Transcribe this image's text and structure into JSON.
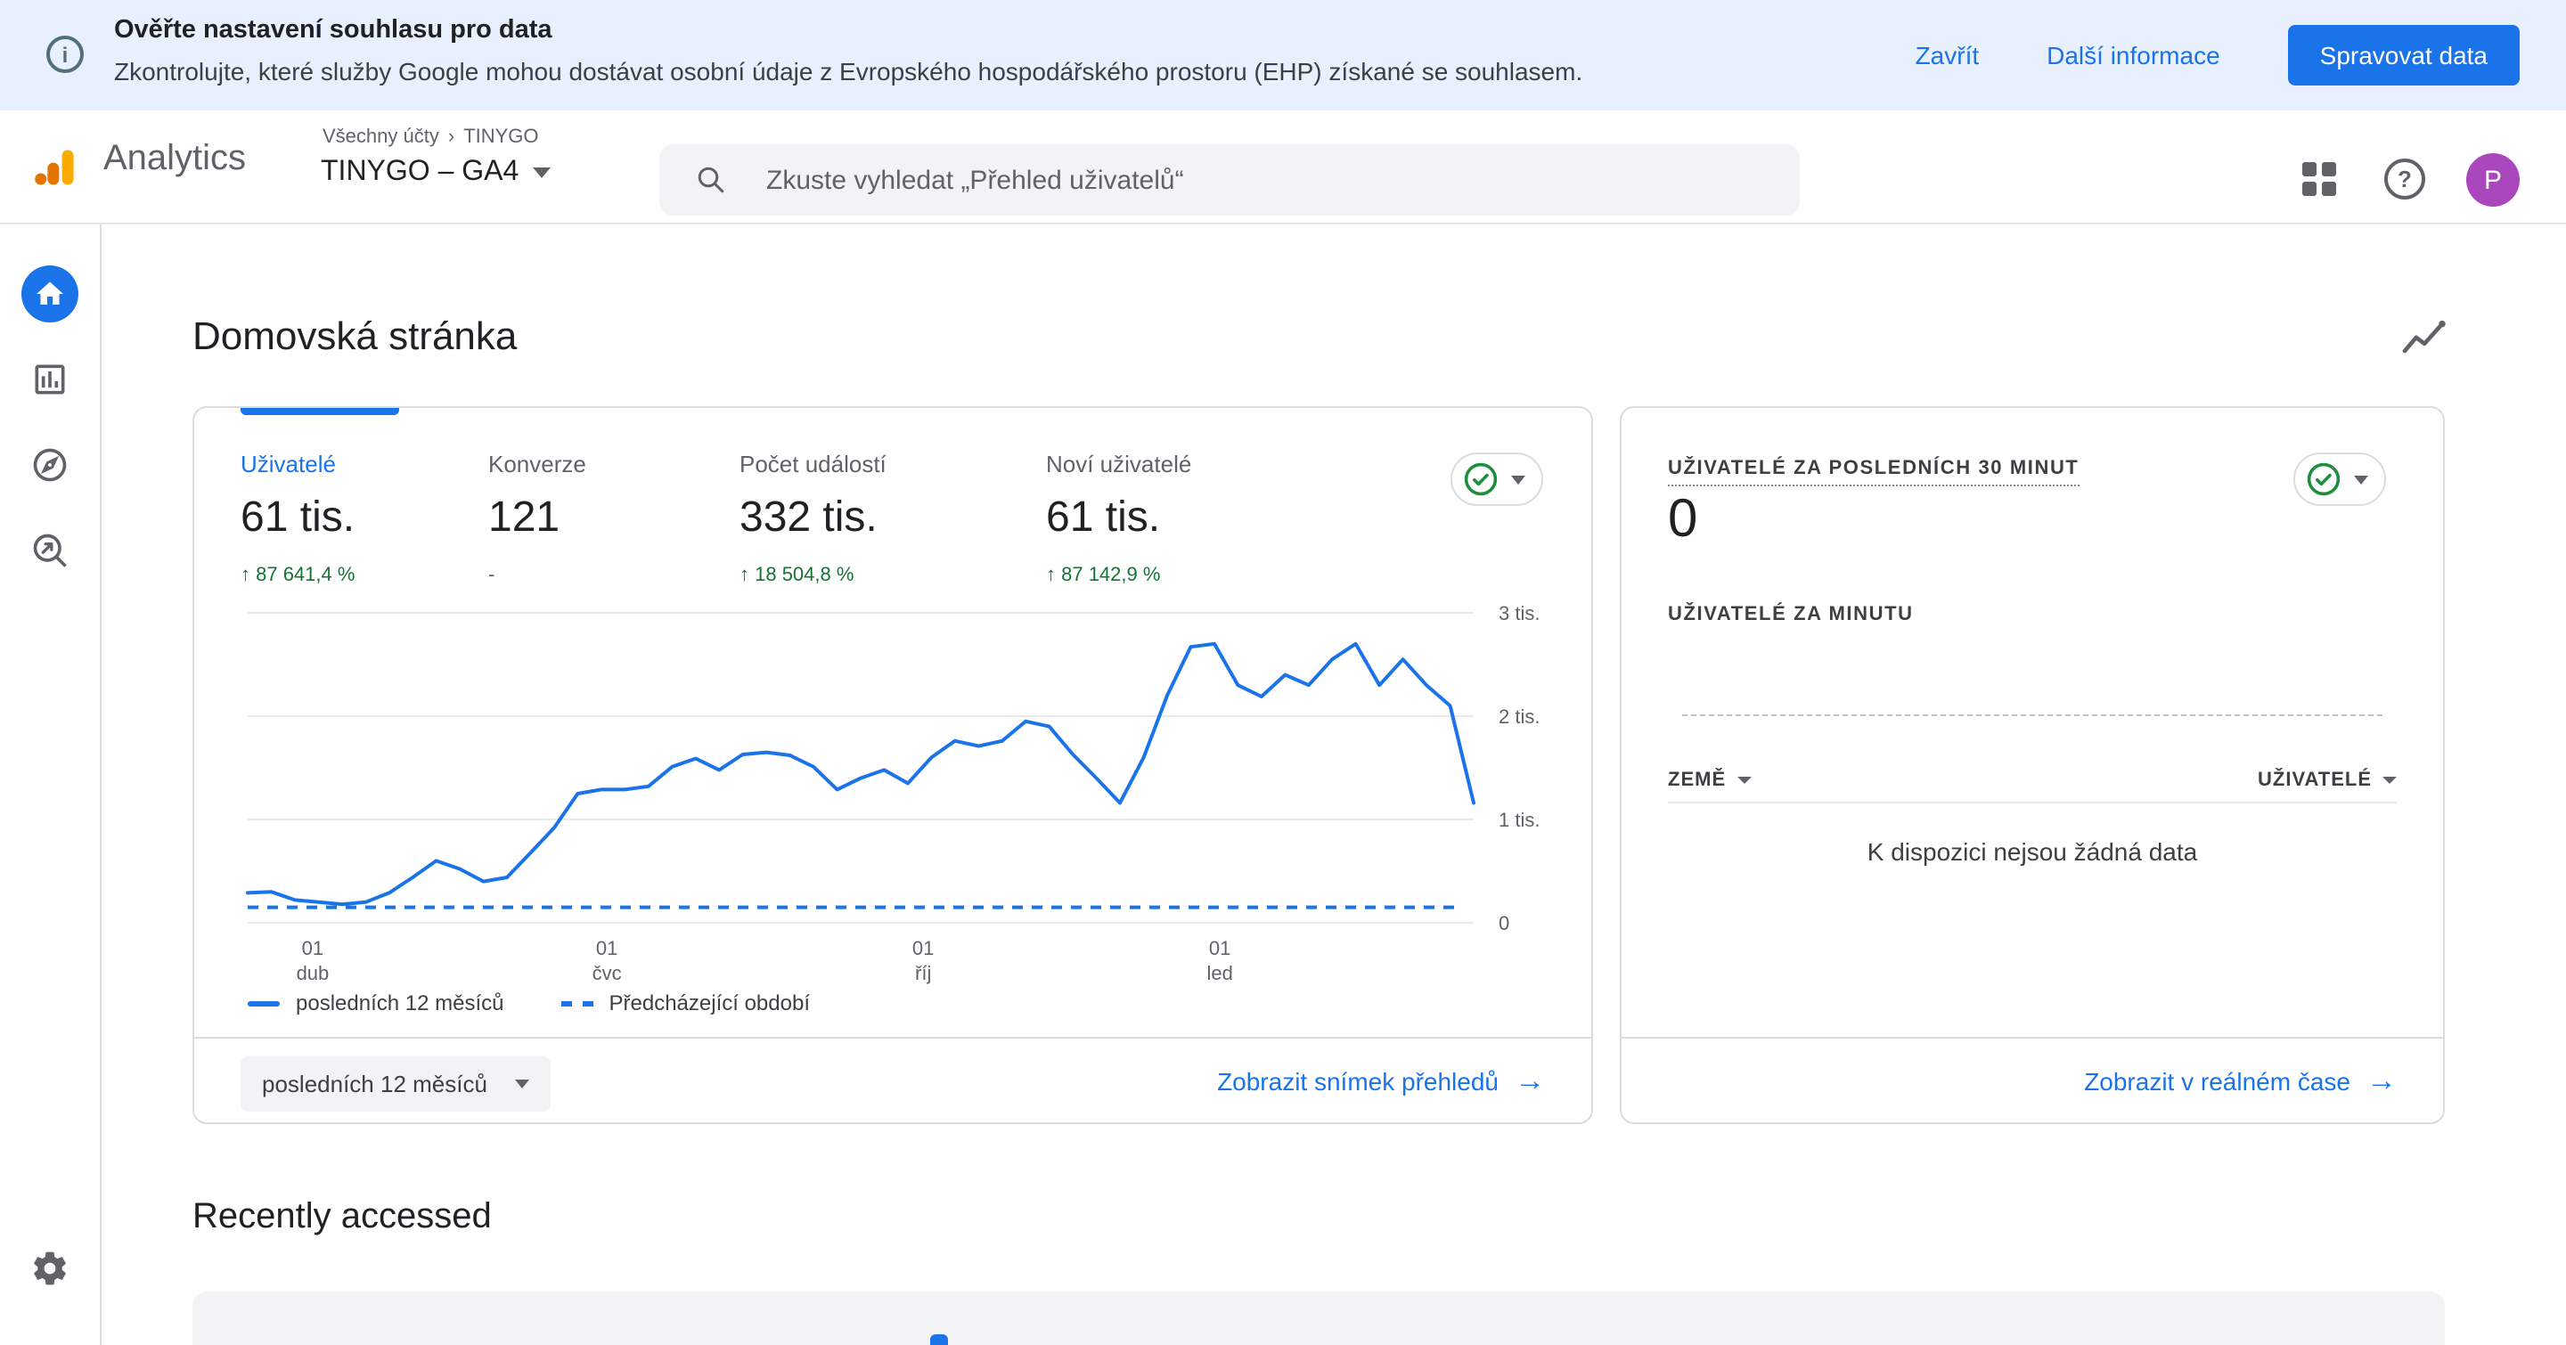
{
  "banner": {
    "title": "Ověřte nastavení souhlasu pro data",
    "subtitle": "Zkontrolujte, které služby Google mohou dostávat osobní údaje z Evropského hospodářského prostoru (EHP) získané se souhlasem.",
    "close_label": "Zavřít",
    "more_info_label": "Další informace",
    "manage_button": "Spravovat data"
  },
  "header": {
    "product": "Analytics",
    "breadcrumb": {
      "account": "Všechny účty",
      "entity": "TINYGO"
    },
    "property_selector": "TINYGO – GA4",
    "search_placeholder": "Zkuste vyhledat „Přehled uživatelů“",
    "avatar_initial": "P"
  },
  "sidebar": {
    "items": [
      {
        "name": "home",
        "active": true
      },
      {
        "name": "reports",
        "active": false
      },
      {
        "name": "explore",
        "active": false
      },
      {
        "name": "advertising",
        "active": false
      },
      {
        "name": "admin-settings",
        "active": false
      }
    ]
  },
  "page": {
    "title": "Domovská stránka",
    "recently_accessed_title": "Recently accessed"
  },
  "overview_card": {
    "metrics": [
      {
        "label": "Uživatelé",
        "value": "61 tis.",
        "delta": "↑ 87 641,4 %",
        "selected": true
      },
      {
        "label": "Konverze",
        "value": "121",
        "delta": "-",
        "selected": false
      },
      {
        "label": "Počet událostí",
        "value": "332 tis.",
        "delta": "↑ 18 504,8 %",
        "selected": false
      },
      {
        "label": "Noví uživatelé",
        "value": "61 tis.",
        "delta": "↑ 87 142,9 %",
        "selected": false
      }
    ],
    "legend": [
      {
        "label": "posledních 12 měsíců",
        "style": "solid"
      },
      {
        "label": "Předcházející období",
        "style": "dashed"
      }
    ],
    "range_selector": "posledních 12 měsíců",
    "snapshot_link": "Zobrazit snímek přehledů",
    "chart_data": {
      "type": "line",
      "title": "Uživatelé — posledních 12 měsíců",
      "unit": "tis.",
      "ylim": [
        0,
        3
      ],
      "yticks": [
        {
          "value": 0,
          "label": "0"
        },
        {
          "value": 1,
          "label": "1 tis."
        },
        {
          "value": 2,
          "label": "2 tis."
        },
        {
          "value": 3,
          "label": "3 tis."
        }
      ],
      "xticks": [
        {
          "pos": 0.053,
          "day": "01",
          "month": "dub"
        },
        {
          "pos": 0.293,
          "day": "01",
          "month": "čvc"
        },
        {
          "pos": 0.551,
          "day": "01",
          "month": "říj"
        },
        {
          "pos": 0.793,
          "day": "01",
          "month": "led"
        }
      ],
      "line_color": "#1a73e8",
      "series": [
        {
          "name": "posledních 12 měsíců",
          "style": "solid",
          "values": [
            0.29,
            0.3,
            0.22,
            0.2,
            0.18,
            0.2,
            0.29,
            0.44,
            0.6,
            0.52,
            0.4,
            0.44,
            0.68,
            0.92,
            1.25,
            1.29,
            1.29,
            1.32,
            1.51,
            1.59,
            1.48,
            1.63,
            1.65,
            1.62,
            1.51,
            1.29,
            1.4,
            1.48,
            1.35,
            1.6,
            1.76,
            1.71,
            1.76,
            1.95,
            1.9,
            1.63,
            1.4,
            1.16,
            1.6,
            2.2,
            2.67,
            2.7,
            2.3,
            2.19,
            2.4,
            2.3,
            2.55,
            2.7,
            2.3,
            2.55,
            2.3,
            2.1,
            1.16
          ]
        },
        {
          "name": "Předcházející období",
          "style": "dashed",
          "values": [
            0.15
          ]
        }
      ]
    }
  },
  "realtime_card": {
    "title": "UŽIVATELÉ ZA POSLEDNÍCH 30 MINUT",
    "value": "0",
    "per_minute_label": "UŽIVATELÉ ZA MINUTU",
    "per_minute_values": [],
    "columns": [
      {
        "label": "ZEMĚ"
      },
      {
        "label": "UŽIVATELÉ"
      }
    ],
    "empty_message": "K dispozici nejsou žádná data",
    "realtime_link": "Zobrazit v reálném čase"
  },
  "icons": {
    "info": "i",
    "question": "?",
    "chevron_right": "›",
    "arrow_right": "→"
  },
  "colors": {
    "accent": "#1a73e8",
    "positive_delta": "#137333",
    "banner_bg": "#e8f0fe",
    "avatar_bg": "#ab47bc",
    "check_circle": "#1e8e3e"
  }
}
